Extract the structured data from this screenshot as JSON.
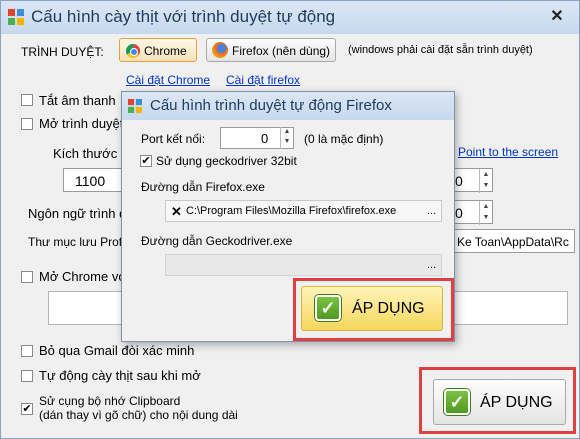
{
  "main": {
    "title": "Cấu hình cày thịt với trình duyệt tự động",
    "close_label": "✕",
    "browser_label": "TRÌNH DUYỆT:",
    "chrome_button": "Chrome",
    "firefox_button": "Firefox (nên dùng)",
    "browser_note": "(windows phải cài đặt sẵn trình duyệt)",
    "install_chrome_link": "Cài đặt Chrome",
    "install_firefox_link": "Cài đặt firefox",
    "mute_label": "Tắt âm thanh",
    "open_browser_label": "Mở trình duyệt t",
    "size_label": "Kích thước c",
    "width_value": "1100",
    "left_spin_value": "0",
    "point_link": "Point to the screen",
    "lang_label": "Ngôn ngữ trình du",
    "lang_spin_value": "0",
    "profile_label": "Thư mục lưu Prof",
    "profile_path": "Ke Toan\\AppData\\Rc",
    "open_chrome_label": "Mở Chrome với",
    "skip_gmail_label": "Bỏ qua Gmail đòi xác minh",
    "auto_farm_label": "Tự động cày thịt sau khi mở",
    "clipboard_label_line1": "Sử cụng bộ nhớ Clipboard",
    "clipboard_label_line2": "(dán thay vì gõ chữ) cho nội dung dài",
    "apply_button": "ÁP DỤNG"
  },
  "dialog": {
    "title": "Cấu hình trình duyệt tự động Firefox",
    "port_label": "Port kết nối:",
    "port_value": "0",
    "port_note": "(0 là mặc định)",
    "gecko32_label": "Sử dụng geckodriver 32bit",
    "firefox_path_label": "Đường dẫn Firefox.exe",
    "firefox_path_value": "C:\\Program Files\\Mozilla Firefox\\firefox.exe",
    "browse_label": "...",
    "gecko_path_label": "Đường dẫn Geckodriver.exe",
    "gecko_path_value": "",
    "apply_button": "ÁP DỤNG"
  },
  "checks": {
    "mute": false,
    "open_browser": false,
    "open_chrome": false,
    "skip_gmail": false,
    "auto_farm": false,
    "clipboard": true,
    "gecko32": true
  }
}
